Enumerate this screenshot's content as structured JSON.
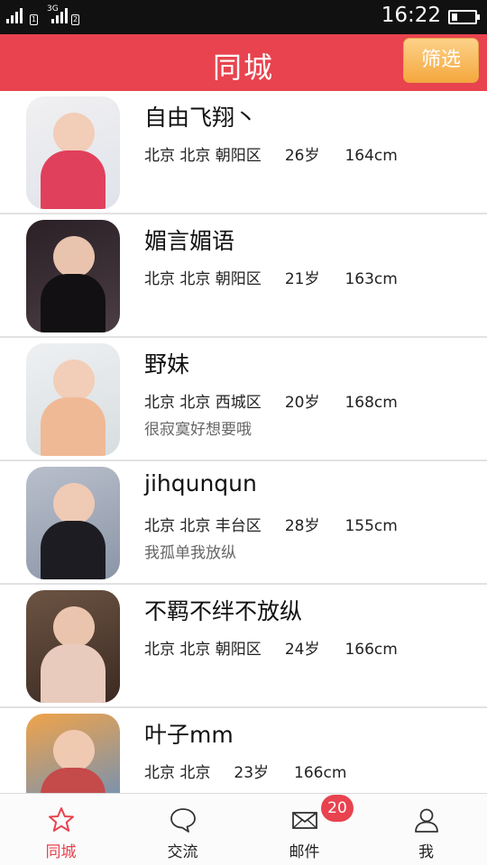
{
  "status_bar": {
    "time": "16:22",
    "signal_icons": [
      "signal-icon",
      "signal-3g-icon"
    ],
    "network_label": "3G",
    "battery_level": 0.2
  },
  "header": {
    "title": "同城",
    "filter_label": "筛选",
    "accent_color": "#e8434f",
    "button_color": "#f5a73e"
  },
  "users": [
    {
      "name": "自由飞翔丶",
      "location": "北京 北京 朝阳区",
      "age": "26岁",
      "height": "164cm",
      "motto": "",
      "photo_colors": [
        "#f1f0f2",
        "#dfe3ea",
        "#e0405c"
      ]
    },
    {
      "name": "媚言媚语",
      "location": "北京 北京 朝阳区",
      "age": "21岁",
      "height": "163cm",
      "motto": "",
      "photo_colors": [
        "#2a2026",
        "#4b3d44",
        "#121012"
      ]
    },
    {
      "name": "野妹",
      "location": "北京 北京 西城区",
      "age": "20岁",
      "height": "168cm",
      "motto": "很寂寞好想要哦",
      "photo_colors": [
        "#eef0f2",
        "#d7dde0",
        "#f0b995"
      ]
    },
    {
      "name": "jihqunqun",
      "location": "北京 北京 丰台区",
      "age": "28岁",
      "height": "155cm",
      "motto": "我孤单我放纵",
      "photo_colors": [
        "#b9bfcc",
        "#8b95a6",
        "#1c1c22"
      ]
    },
    {
      "name": "不羁不绊不放纵",
      "location": "北京 北京 朝阳区",
      "age": "24岁",
      "height": "166cm",
      "motto": "",
      "photo_colors": [
        "#6c5443",
        "#3b2a22",
        "#e9cbbd"
      ]
    },
    {
      "name": "叶子mm",
      "location": "北京 北京",
      "age": "23岁",
      "height": "166cm",
      "motto": "",
      "photo_colors": [
        "#f0a34a",
        "#5b8ec9",
        "#c54a4a"
      ]
    }
  ],
  "tabs": [
    {
      "label": "同城",
      "icon": "star-icon",
      "active": true
    },
    {
      "label": "交流",
      "icon": "chat-bubble-icon",
      "active": false
    },
    {
      "label": "邮件",
      "icon": "mail-icon",
      "active": false
    },
    {
      "label": "我",
      "icon": "user-icon",
      "active": false
    }
  ],
  "mail_badge": "20"
}
